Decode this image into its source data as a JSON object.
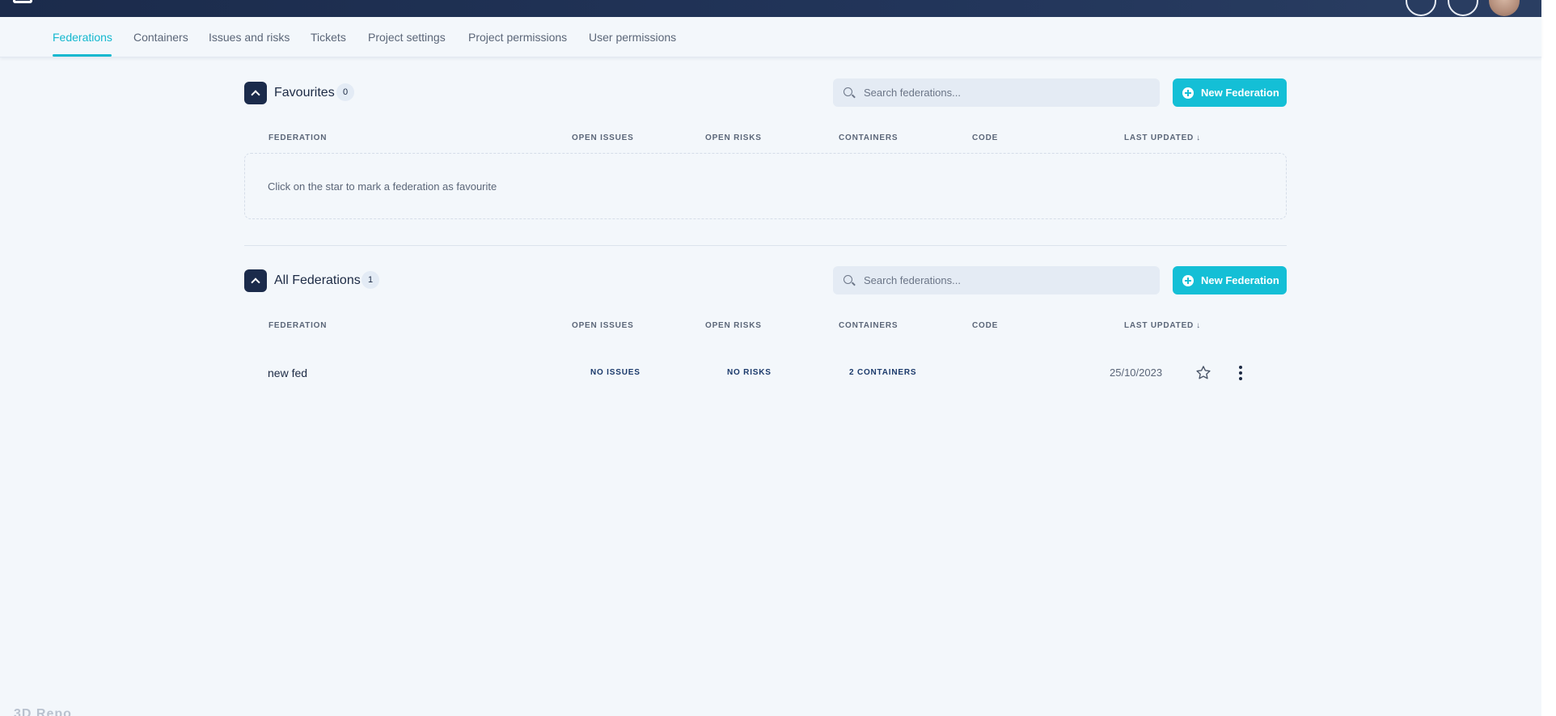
{
  "tabs": [
    {
      "label": "Federations",
      "active": true
    },
    {
      "label": "Containers",
      "active": false
    },
    {
      "label": "Issues and risks",
      "active": false
    },
    {
      "label": "Tickets",
      "active": false
    },
    {
      "label": "Project settings",
      "active": false
    },
    {
      "label": "Project permissions",
      "active": false
    },
    {
      "label": "User permissions",
      "active": false
    }
  ],
  "favourites": {
    "title": "Favourites",
    "count": "0",
    "search_placeholder": "Search federations...",
    "new_button": "New Federation",
    "empty_message": "Click on the star to mark a federation as favourite"
  },
  "all_federations": {
    "title": "All Federations",
    "count": "1",
    "search_placeholder": "Search federations...",
    "new_button": "New Federation"
  },
  "columns": {
    "federation": "FEDERATION",
    "open_issues": "OPEN ISSUES",
    "open_risks": "OPEN RISKS",
    "containers": "CONTAINERS",
    "code": "CODE",
    "last_updated": "LAST UPDATED",
    "sort_arrow": "↓"
  },
  "rows": [
    {
      "name": "new fed",
      "issues": "NO ISSUES",
      "risks": "NO RISKS",
      "containers": "2 CONTAINERS",
      "code": "",
      "last_updated": "25/10/2023",
      "favourite": false
    }
  ],
  "footer": {
    "logo_text": "3D Repo"
  },
  "colors": {
    "accent": "#14bfd6",
    "navy": "#1b2b4b",
    "background": "#f3f7fb"
  },
  "icons": {
    "toggle": "chevron-up-icon",
    "search": "search-icon",
    "new": "plus-circle-icon",
    "favourite": "star-outline-icon",
    "more": "more-vertical-icon"
  }
}
